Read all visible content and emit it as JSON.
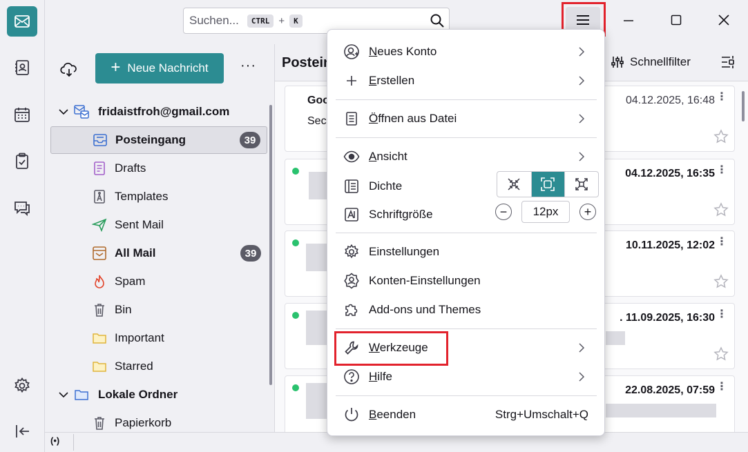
{
  "spaces": {
    "items": [
      {
        "name": "mail-icon",
        "active": true
      },
      {
        "name": "address-book-icon",
        "active": false
      },
      {
        "name": "calendar-icon",
        "active": false
      },
      {
        "name": "tasks-icon",
        "active": false
      },
      {
        "name": "chat-icon",
        "active": false
      }
    ],
    "settings": "gear-icon",
    "collapse": "collapse-left-icon"
  },
  "titlebar": {
    "search_placeholder": "Suchen...",
    "shortcut_key1": "CTRL",
    "shortcut_plus": "+",
    "shortcut_key2": "K"
  },
  "folder_pane": {
    "new_message_label": "Neue Nachricht",
    "more_label": "···",
    "account": "fridaistfroh@gmail.com",
    "folders": [
      {
        "label": "Posteingang",
        "icon": "inbox-icon",
        "badge": "39",
        "selected": true,
        "bold": true
      },
      {
        "label": "Drafts",
        "icon": "drafts-icon"
      },
      {
        "label": "Templates",
        "icon": "templates-icon"
      },
      {
        "label": "Sent Mail",
        "icon": "sent-icon"
      },
      {
        "label": "All Mail",
        "icon": "archive-icon",
        "badge": "39",
        "bold": true
      },
      {
        "label": "Spam",
        "icon": "spam-icon"
      },
      {
        "label": "Bin",
        "icon": "trash-icon"
      },
      {
        "label": "Important",
        "icon": "folder-icon"
      },
      {
        "label": "Starred",
        "icon": "folder-icon"
      }
    ],
    "local_account": "Lokale Ordner",
    "local_folders": [
      {
        "label": "Papierkorb",
        "icon": "trash-icon"
      }
    ]
  },
  "thread_pane": {
    "title": "Postein",
    "quickfilter_label": "Schnellfilter",
    "messages": [
      {
        "sender": "Goo",
        "subject": "Secu",
        "date": "04.12.2025, 16:48",
        "unread": false
      },
      {
        "sender": "",
        "subject": "",
        "date": "04.12.2025, 16:35",
        "unread": true
      },
      {
        "sender": "",
        "subject": "",
        "date": "10.11.2025, 12:02",
        "unread": true
      },
      {
        "sender": "",
        "subject": "",
        "date": ". 11.09.2025, 16:30",
        "unread": true
      },
      {
        "sender": "",
        "subject": "",
        "date": "22.08.2025, 07:59",
        "unread": true
      }
    ]
  },
  "statusbar": {
    "online_icon": "(•)"
  },
  "app_menu": {
    "new_account": {
      "pre": "",
      "u": "N",
      "post": "eues Konto"
    },
    "create": {
      "pre": "",
      "u": "E",
      "post": "rstellen"
    },
    "open_file": {
      "pre": "",
      "u": "Ö",
      "post": "ffnen aus Datei"
    },
    "view": {
      "pre": "",
      "u": "A",
      "post": "nsicht"
    },
    "density_label": "Dichte",
    "density_selected": "normal",
    "font_size_label": "Schriftgröße",
    "font_size_minus": "−",
    "font_size_value": "12px",
    "font_size_plus": "+",
    "settings_label": "Einstellungen",
    "account_settings_label": "Konten-Einstellungen",
    "addons_label": "Add-ons und Themes",
    "tools": {
      "pre": "",
      "u": "W",
      "post": "erkzeuge"
    },
    "help": {
      "pre": "",
      "u": "H",
      "post": "ilfe"
    },
    "quit": {
      "pre": "",
      "u": "B",
      "post": "eenden"
    },
    "quit_shortcut": "Strg+Umschalt+Q"
  },
  "colors": {
    "accent": "#2c8c92",
    "highlight_frame": "#e2222c",
    "unread_dot": "#2ac26e"
  }
}
